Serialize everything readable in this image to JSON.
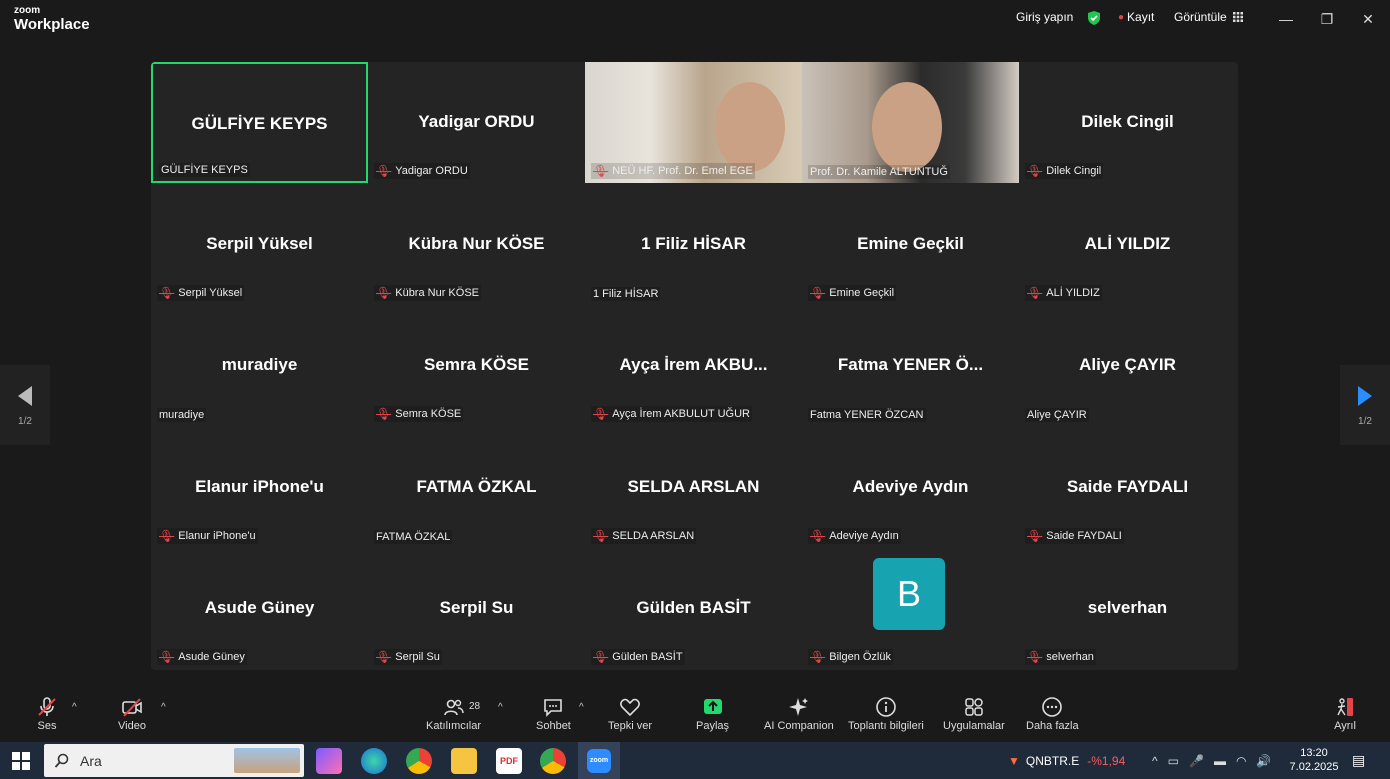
{
  "titlebar": {
    "logo_top": "zoom",
    "logo_bottom": "Workplace",
    "signin": "Giriş yapın",
    "record": "Kayıt",
    "view": "Görüntüle"
  },
  "tiles": [
    {
      "name": "GÜLFİYE KEYPS",
      "label": "GÜLFİYE KEYPS",
      "muted": false,
      "active": true
    },
    {
      "name": "Yadigar ORDU",
      "label": "Yadigar ORDU",
      "muted": true
    },
    {
      "name": "",
      "label": "NEÜ HF. Prof. Dr. Emel EGE",
      "muted": true,
      "video": true
    },
    {
      "name": "",
      "label": "Prof. Dr. Kamile ALTUNTUĞ",
      "muted": false,
      "video": true
    },
    {
      "name": "Dilek Cingil",
      "label": "Dilek Cingil",
      "muted": true
    },
    {
      "name": "Serpil Yüksel",
      "label": "Serpil Yüksel",
      "muted": true
    },
    {
      "name": "Kübra Nur KÖSE",
      "label": "Kübra Nur KÖSE",
      "muted": true
    },
    {
      "name": "1 Filiz HİSAR",
      "label": "1 Filiz HİSAR",
      "muted": false
    },
    {
      "name": "Emine Geçkil",
      "label": "Emine Geçkil",
      "muted": true
    },
    {
      "name": "ALİ YILDIZ",
      "label": "ALİ YILDIZ",
      "muted": true
    },
    {
      "name": "muradiye",
      "label": "muradiye",
      "muted": false
    },
    {
      "name": "Semra KÖSE",
      "label": "Semra KÖSE",
      "muted": true
    },
    {
      "name": "Ayça İrem AKBU...",
      "label": "Ayça İrem AKBULUT UĞUR",
      "muted": true
    },
    {
      "name": "Fatma YENER Ö...",
      "label": "Fatma YENER ÖZCAN",
      "muted": false
    },
    {
      "name": "Aliye ÇAYIR",
      "label": "Aliye ÇAYIR",
      "muted": false
    },
    {
      "name": "Elanur iPhone'u",
      "label": "Elanur iPhone'u",
      "muted": true
    },
    {
      "name": "FATMA ÖZKAL",
      "label": "FATMA ÖZKAL",
      "muted": false
    },
    {
      "name": "SELDA ARSLAN",
      "label": "SELDA ARSLAN",
      "muted": true
    },
    {
      "name": "Adeviye Aydın",
      "label": "Adeviye Aydın",
      "muted": true
    },
    {
      "name": "Saide FAYDALI",
      "label": "Saide FAYDALI",
      "muted": true
    },
    {
      "name": "Asude Güney",
      "label": "Asude Güney",
      "muted": true
    },
    {
      "name": "Serpil Su",
      "label": "Serpil Su",
      "muted": true
    },
    {
      "name": "Gülden BASİT",
      "label": "Gülden BASİT",
      "muted": true
    },
    {
      "name": "",
      "label": "Bilgen Özlük",
      "muted": true,
      "avatar": "B"
    },
    {
      "name": "selverhan",
      "label": "selverhan",
      "muted": true
    }
  ],
  "pager": {
    "left": "1/2",
    "right": "1/2"
  },
  "toolbar": {
    "audio": "Ses",
    "video": "Video",
    "participants": "Katılımcılar",
    "participants_count": "28",
    "chat": "Sohbet",
    "reactions": "Tepki ver",
    "share": "Paylaş",
    "ai": "AI Companion",
    "info": "Toplantı bilgileri",
    "apps": "Uygulamalar",
    "more": "Daha fazla",
    "leave": "Ayrıl"
  },
  "taskbar": {
    "search": "Ara",
    "stock": "QNBTR.E",
    "stock_change": "-%1,94",
    "time": "13:20",
    "date": "7.02.2025",
    "zoom_icon": "zoom"
  },
  "colors": {
    "active_border": "#23d96c",
    "muted_icon": "#e0464a",
    "share": "#23d96c",
    "avatar": "#18a3b1"
  }
}
